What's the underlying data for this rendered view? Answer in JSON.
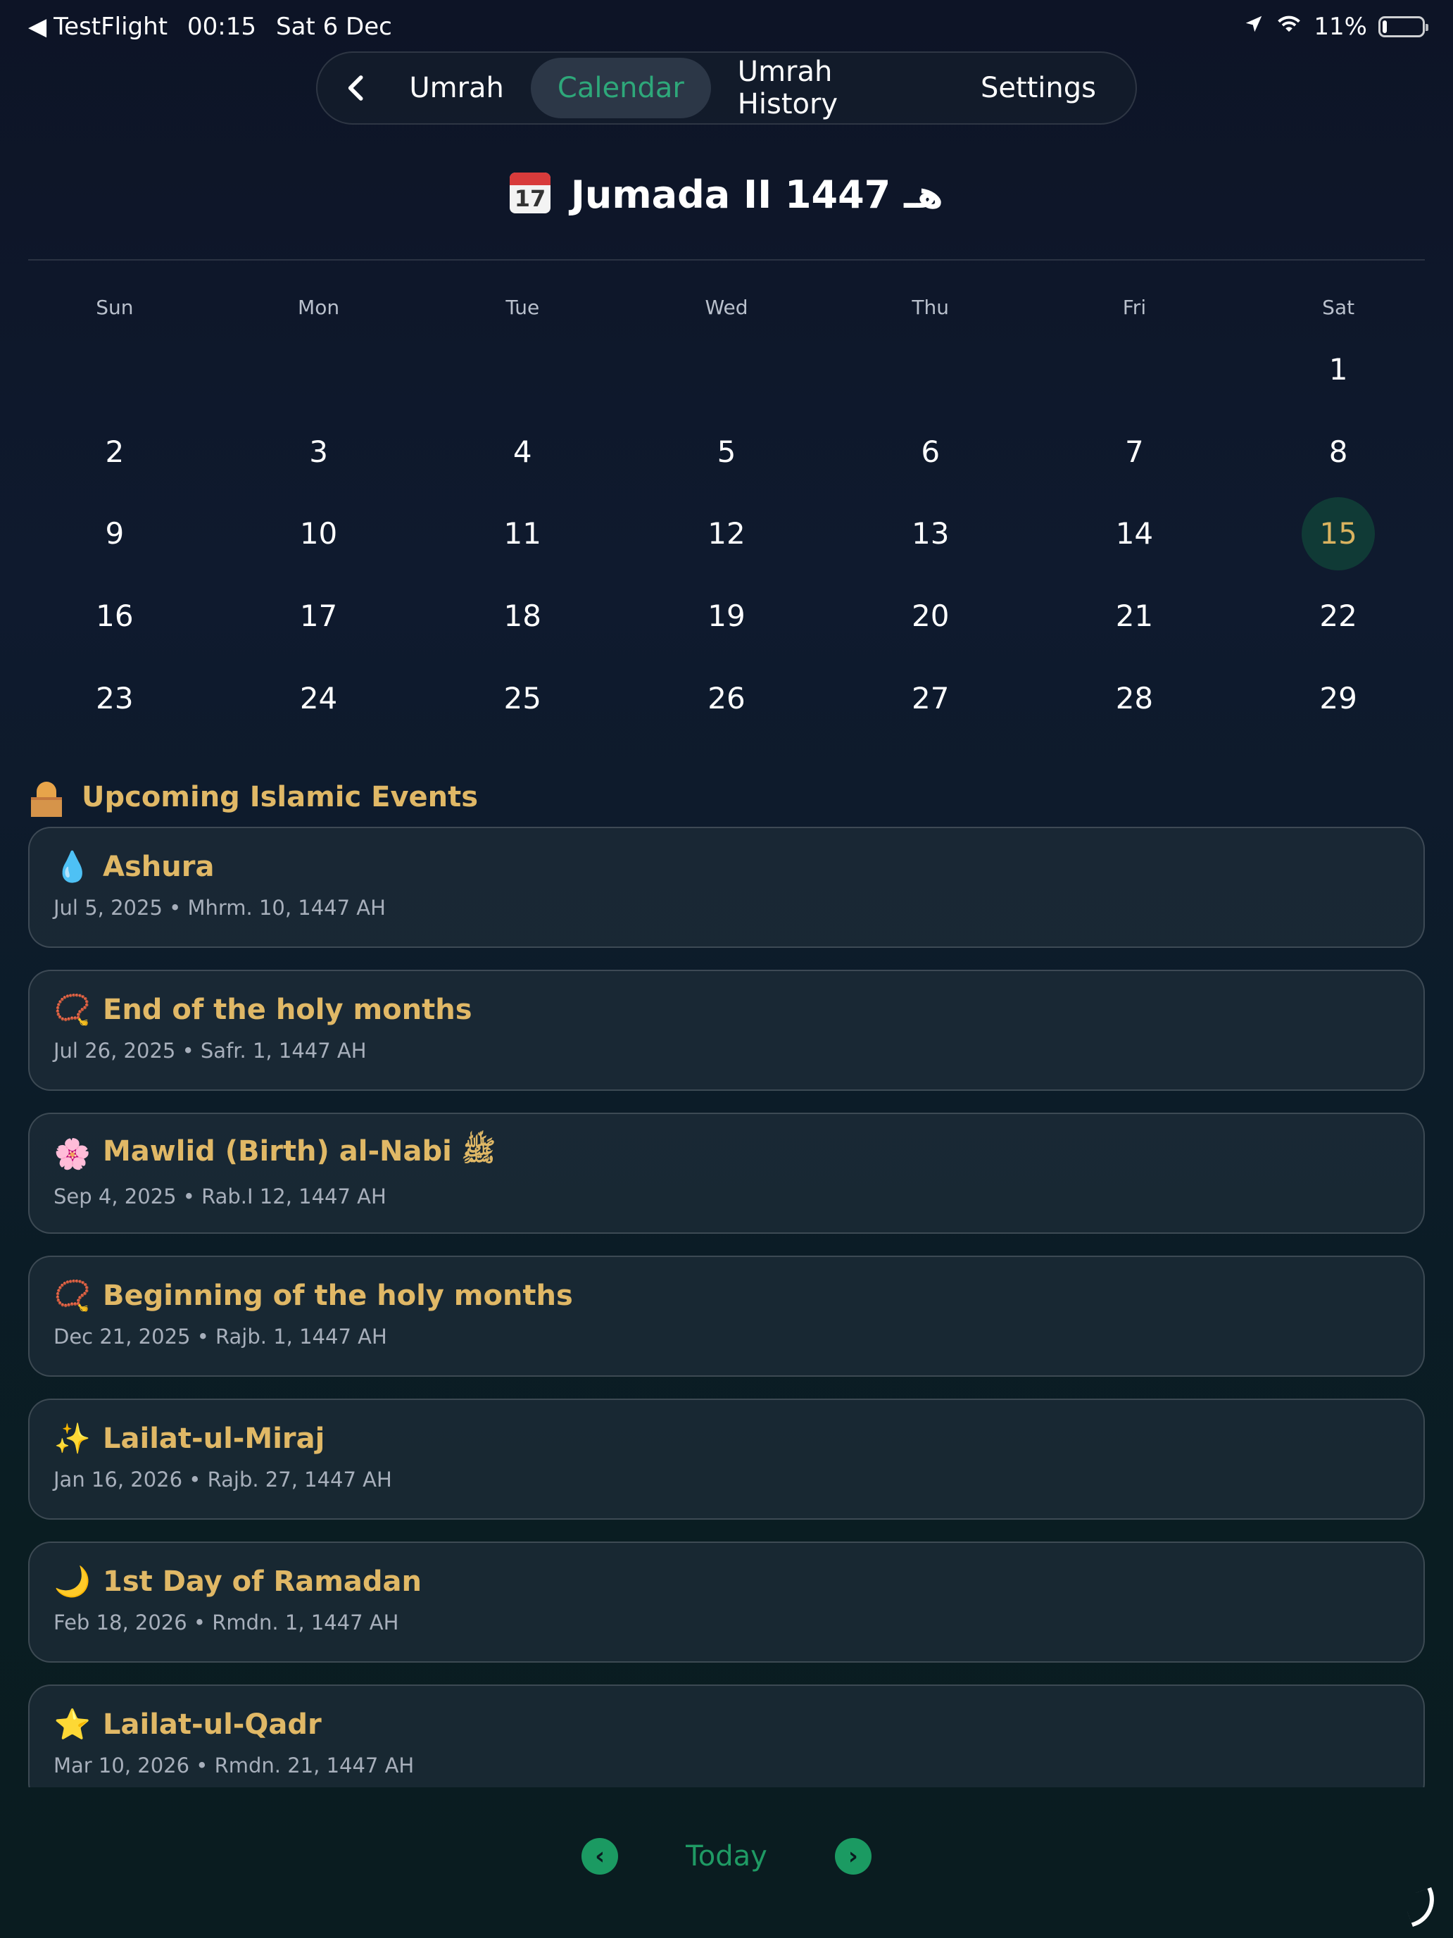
{
  "status_bar": {
    "back_app": "TestFlight",
    "time": "00:15",
    "date": "Sat 6 Dec",
    "battery": "11%",
    "battery_level": 0.11
  },
  "nav": {
    "tabs": [
      {
        "label": "Umrah",
        "active": false
      },
      {
        "label": "Calendar",
        "active": true
      },
      {
        "label": "Umrah History",
        "active": false
      },
      {
        "label": "Settings",
        "active": false
      }
    ]
  },
  "calendar": {
    "month_title": "Jumada II 1447 هـ",
    "calendar_emoji_day": "17",
    "weekdays": [
      "Sun",
      "Mon",
      "Tue",
      "Wed",
      "Thu",
      "Fri",
      "Sat"
    ],
    "leading_blank_days": 6,
    "days": [
      "1",
      "2",
      "3",
      "4",
      "5",
      "6",
      "7",
      "8",
      "9",
      "10",
      "11",
      "12",
      "13",
      "14",
      "15",
      "16",
      "17",
      "18",
      "19",
      "20",
      "21",
      "22",
      "23",
      "24",
      "25",
      "26",
      "27",
      "28",
      "29"
    ],
    "today": "15"
  },
  "events": {
    "title": "Upcoming Islamic Events",
    "items": [
      {
        "icon": "droplet-icon",
        "glyph": "💧",
        "name": "Ashura",
        "date": "Jul 5, 2025 • Mhrm. 10, 1447 AH"
      },
      {
        "icon": "prayer-beads-icon",
        "glyph": "📿",
        "name": "End of the holy months",
        "date": "Jul 26, 2025 • Safr. 1, 1447 AH"
      },
      {
        "icon": "blossom-icon",
        "glyph": "🌸",
        "name": "Mawlid (Birth) al-Nabi ﷺ",
        "date": "Sep 4, 2025 • Rab.I 12, 1447 AH"
      },
      {
        "icon": "prayer-beads-icon",
        "glyph": "📿",
        "name": "Beginning of the holy months",
        "date": "Dec 21, 2025 • Rajb. 1, 1447 AH"
      },
      {
        "icon": "sparkles-icon",
        "glyph": "✨",
        "name": "Lailat-ul-Miraj",
        "date": "Jan 16, 2026 • Rajb. 27, 1447 AH"
      },
      {
        "icon": "crescent-moon-icon",
        "glyph": "🌙",
        "name": "1st Day of Ramadan",
        "date": "Feb 18, 2026 • Rmdn. 1, 1447 AH"
      },
      {
        "icon": "star-icon",
        "glyph": "⭐",
        "name": "Lailat-ul-Qadr",
        "date": "Mar 10, 2026 • Rmdn. 21, 1447 AH"
      }
    ]
  },
  "bottom_bar": {
    "prev_glyph": "‹",
    "next_glyph": "›",
    "today_label": "Today"
  },
  "colors": {
    "accent_green": "#2ea87a",
    "gold": "#e0b866",
    "today_circle": "#103a36"
  }
}
